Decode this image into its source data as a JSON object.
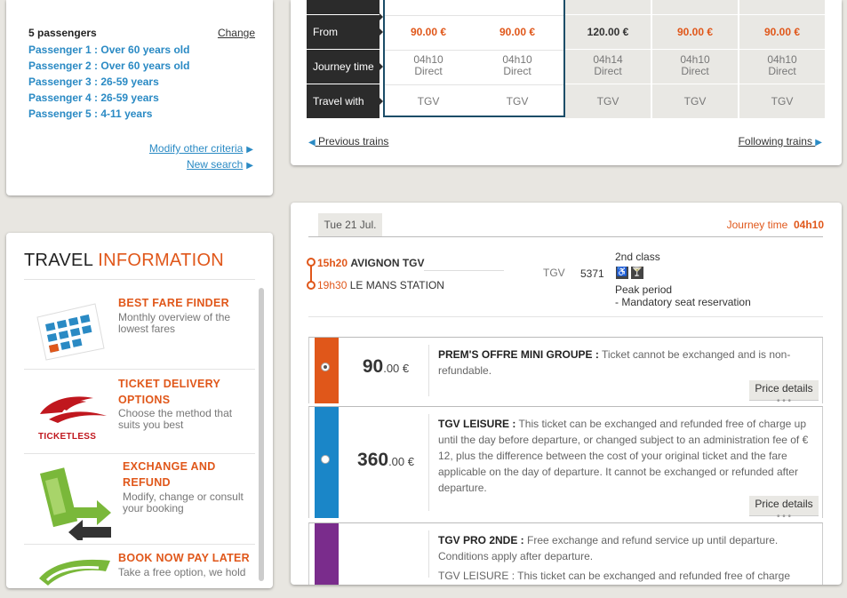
{
  "passengers": {
    "header": "5 passengers",
    "change_label": "Change",
    "list": [
      "Passenger  1 : Over 60 years old",
      "Passenger  2 : Over 60 years old",
      "Passenger  3 : 26-59 years",
      "Passenger  4 : 26-59 years",
      "Passenger  5 : 4-11 years"
    ],
    "modify_label": "Modify other criteria",
    "new_search_label": "New search"
  },
  "travel_info": {
    "title_part1": "TRAVEL ",
    "title_part2": "INFORMATION",
    "items": [
      {
        "title": "BEST FARE FINDER",
        "desc": "Monthly overview of the lowest fares"
      },
      {
        "title": "TICKET DELIVERY OPTIONS",
        "desc": "Choose the method that suits you best",
        "logo": "TICKETLESS"
      },
      {
        "title": "EXCHANGE AND REFUND",
        "desc": "Modify, change or consult your booking"
      },
      {
        "title": "BOOK NOW PAY LATER",
        "desc": "Take a free option, we hold"
      }
    ]
  },
  "train_table": {
    "row_labels": [
      "From",
      "Journey time",
      "Travel with"
    ],
    "columns": [
      {
        "price": "90.00 €",
        "duration": "04h10",
        "type": "Direct",
        "travel": "TGV",
        "selected": true
      },
      {
        "price": "90.00 €",
        "duration": "04h10",
        "type": "Direct",
        "travel": "TGV",
        "selected": true
      },
      {
        "price": "120.00 €",
        "duration": "04h14",
        "type": "Direct",
        "travel": "TGV",
        "selected": false
      },
      {
        "price": "90.00 €",
        "duration": "04h10",
        "type": "Direct",
        "travel": "TGV",
        "selected": false
      },
      {
        "price": "90.00 €",
        "duration": "04h10",
        "type": "Direct",
        "travel": "TGV",
        "selected": false
      }
    ],
    "previous_label": "Previous trains",
    "following_label": "Following trains"
  },
  "journey": {
    "date": "Tue 21 Jul.",
    "journey_time_label": "Journey time",
    "journey_time_value": "04h10",
    "depart_time": "15h20",
    "depart_station": "AVIGNON TGV",
    "arrive_time": "19h30",
    "arrive_station": "LE MANS STATION",
    "train_type": "TGV",
    "train_number": "5371",
    "class_label": "2nd class",
    "period": "Peak period",
    "reservation_note": "- Mandatory seat reservation"
  },
  "fares": [
    {
      "price_int": "90",
      "price_dec": ".00 €",
      "name": "PREM'S OFFRE MINI GROUPE :",
      "text": " Ticket cannot be exchanged and is non-refundable.",
      "color": "#e0571a",
      "selected": true,
      "details_label": "Price details"
    },
    {
      "price_int": "360",
      "price_dec": ".00 €",
      "name": "TGV LEISURE :",
      "text": " This ticket can be exchanged and refunded free of charge up until the day before departure, or changed subject to an administration fee of € 12, plus the difference between the cost of your original ticket and the fare applicable on the day of departure. It cannot be exchanged or refunded after departure.",
      "color": "#1a86c8",
      "selected": false,
      "details_label": "Price details"
    },
    {
      "name": "TGV PRO 2NDE :",
      "text": " Free exchange and refund service up until departure. Conditions apply after departure.",
      "color": "#7a2c8c",
      "extra": "TGV LEISURE : This ticket can be exchanged and refunded free of charge"
    }
  ],
  "colors": {
    "accent": "#e0571a",
    "link": "#2a8ac4",
    "dark": "#2b2b2b",
    "selected_border": "#1c4d68"
  }
}
